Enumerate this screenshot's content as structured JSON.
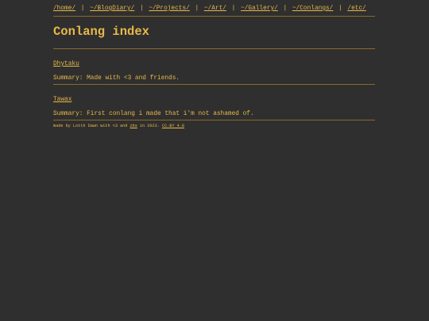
{
  "nav": {
    "items": [
      "/home/",
      "~/BlogDiary/",
      "~/Projects/",
      "~/Art/",
      "~/Gallery/",
      "~/Conlangs/",
      "/etc/"
    ],
    "separator": "|"
  },
  "main": {
    "title": "Conlang index",
    "entries": [
      {
        "name": "Dhytaku",
        "summary": "Summary: Made with <3 and friends."
      },
      {
        "name": "Tawax",
        "summary": "Summary: First conlang i made that i'm not ashamed of."
      }
    ]
  },
  "footer": {
    "text_before": "made by Lottk Dawn with <3 and ",
    "link1": "zbs",
    "text_middle": " in 2023. ",
    "link2": "CC-BY 4.0"
  },
  "colors": {
    "background": "#2f2f2f",
    "accent": "#e8b84a",
    "rule": "#8a6a2a"
  }
}
